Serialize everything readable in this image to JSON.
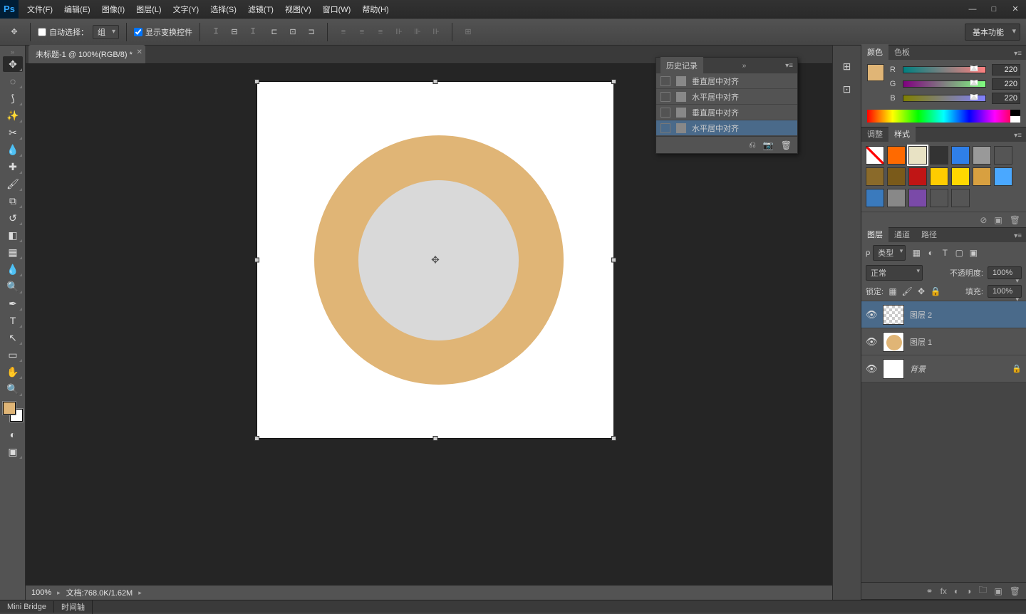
{
  "menu": [
    "文件(F)",
    "编辑(E)",
    "图像(I)",
    "图层(L)",
    "文字(Y)",
    "选择(S)",
    "滤镜(T)",
    "视图(V)",
    "窗口(W)",
    "帮助(H)"
  ],
  "options": {
    "auto_select_label": "自动选择：",
    "auto_select_value": "组",
    "show_transform": "显示变换控件",
    "workspace": "基本功能"
  },
  "tab": {
    "title": "未标题-1 @ 100%(RGB/8) *"
  },
  "statusbar": {
    "zoom": "100%",
    "doc": "文档:768.0K/1.62M"
  },
  "history": {
    "title": "历史记录",
    "items": [
      {
        "label": "垂直居中对齐",
        "sel": false
      },
      {
        "label": "水平居中对齐",
        "sel": false
      },
      {
        "label": "垂直居中对齐",
        "sel": false
      },
      {
        "label": "水平居中对齐",
        "sel": true
      }
    ]
  },
  "panels": {
    "color": {
      "tab1": "颜色",
      "tab2": "色板",
      "r": "R",
      "g": "G",
      "b": "B",
      "rv": "220",
      "gv": "220",
      "bv": "220"
    },
    "styles": {
      "tab1": "调整",
      "tab2": "样式",
      "swatches": [
        "#fff",
        "#ff6a00",
        "#e8e2c4",
        "#333",
        "#2f7fe8",
        "#999",
        "#555",
        "#8a6a2a",
        "#7a5a1a",
        "#c01515",
        "#ffcc00",
        "#ffd800",
        "#d8a040",
        "#4aa8ff",
        "#3a7abd",
        "#888",
        "#7a4aa8",
        "transparent",
        "transparent"
      ]
    },
    "layers_tabs": {
      "t1": "图层",
      "t2": "通道",
      "t3": "路径"
    },
    "layers": {
      "filter_label": "类型",
      "blend": "正常",
      "opacity_label": "不透明度:",
      "opacity_val": "100%",
      "lock_label": "锁定:",
      "fill_label": "填充:",
      "fill_val": "100%",
      "rows": [
        {
          "name": "图层 2",
          "sel": true,
          "type": "trans"
        },
        {
          "name": "图层 1",
          "sel": false,
          "type": "circle"
        },
        {
          "name": "背景",
          "sel": false,
          "type": "bg",
          "locked": true
        }
      ]
    }
  },
  "bottom": {
    "t1": "Mini Bridge",
    "t2": "时间轴"
  }
}
